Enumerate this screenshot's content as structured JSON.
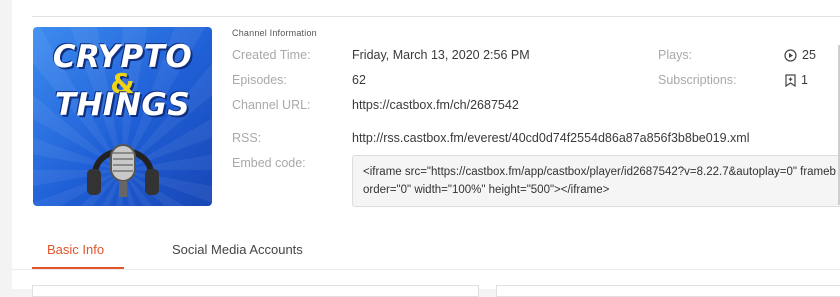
{
  "cover": {
    "line1": "CRYPTO",
    "ampersand": "&",
    "line2": "THINGS"
  },
  "channel_info": {
    "section_title": "Channel Information",
    "created_time_label": "Created Time:",
    "created_time": "Friday, March 13, 2020 2:56 PM",
    "episodes_label": "Episodes:",
    "episodes": "62",
    "channel_url_label": "Channel URL:",
    "channel_url": "https://castbox.fm/ch/2687542",
    "rss_label": "RSS:",
    "rss": "http://rss.castbox.fm/everest/40cd0d74f2554d86a87a856f3b8be019.xml",
    "embed_label": "Embed code:",
    "embed_code": "<iframe src=\"https://castbox.fm/app/castbox/player/id2687542?v=8.22.7&autoplay=0\" frameborder=\"0\" width=\"100%\" height=\"500\"></iframe>",
    "plays_label": "Plays:",
    "plays": "25",
    "subscriptions_label": "Subscriptions:",
    "subscriptions": "1"
  },
  "tabs": [
    {
      "label": "Basic Info",
      "active": true
    },
    {
      "label": "Social Media Accounts",
      "active": false
    }
  ],
  "colors": {
    "accent": "#e0552b",
    "cover_blue": "#1f5fd6",
    "cover_yellow": "#f2d417"
  },
  "icons": {
    "plays": "play-circle-icon",
    "subscriptions": "bookmark-plus-icon"
  }
}
